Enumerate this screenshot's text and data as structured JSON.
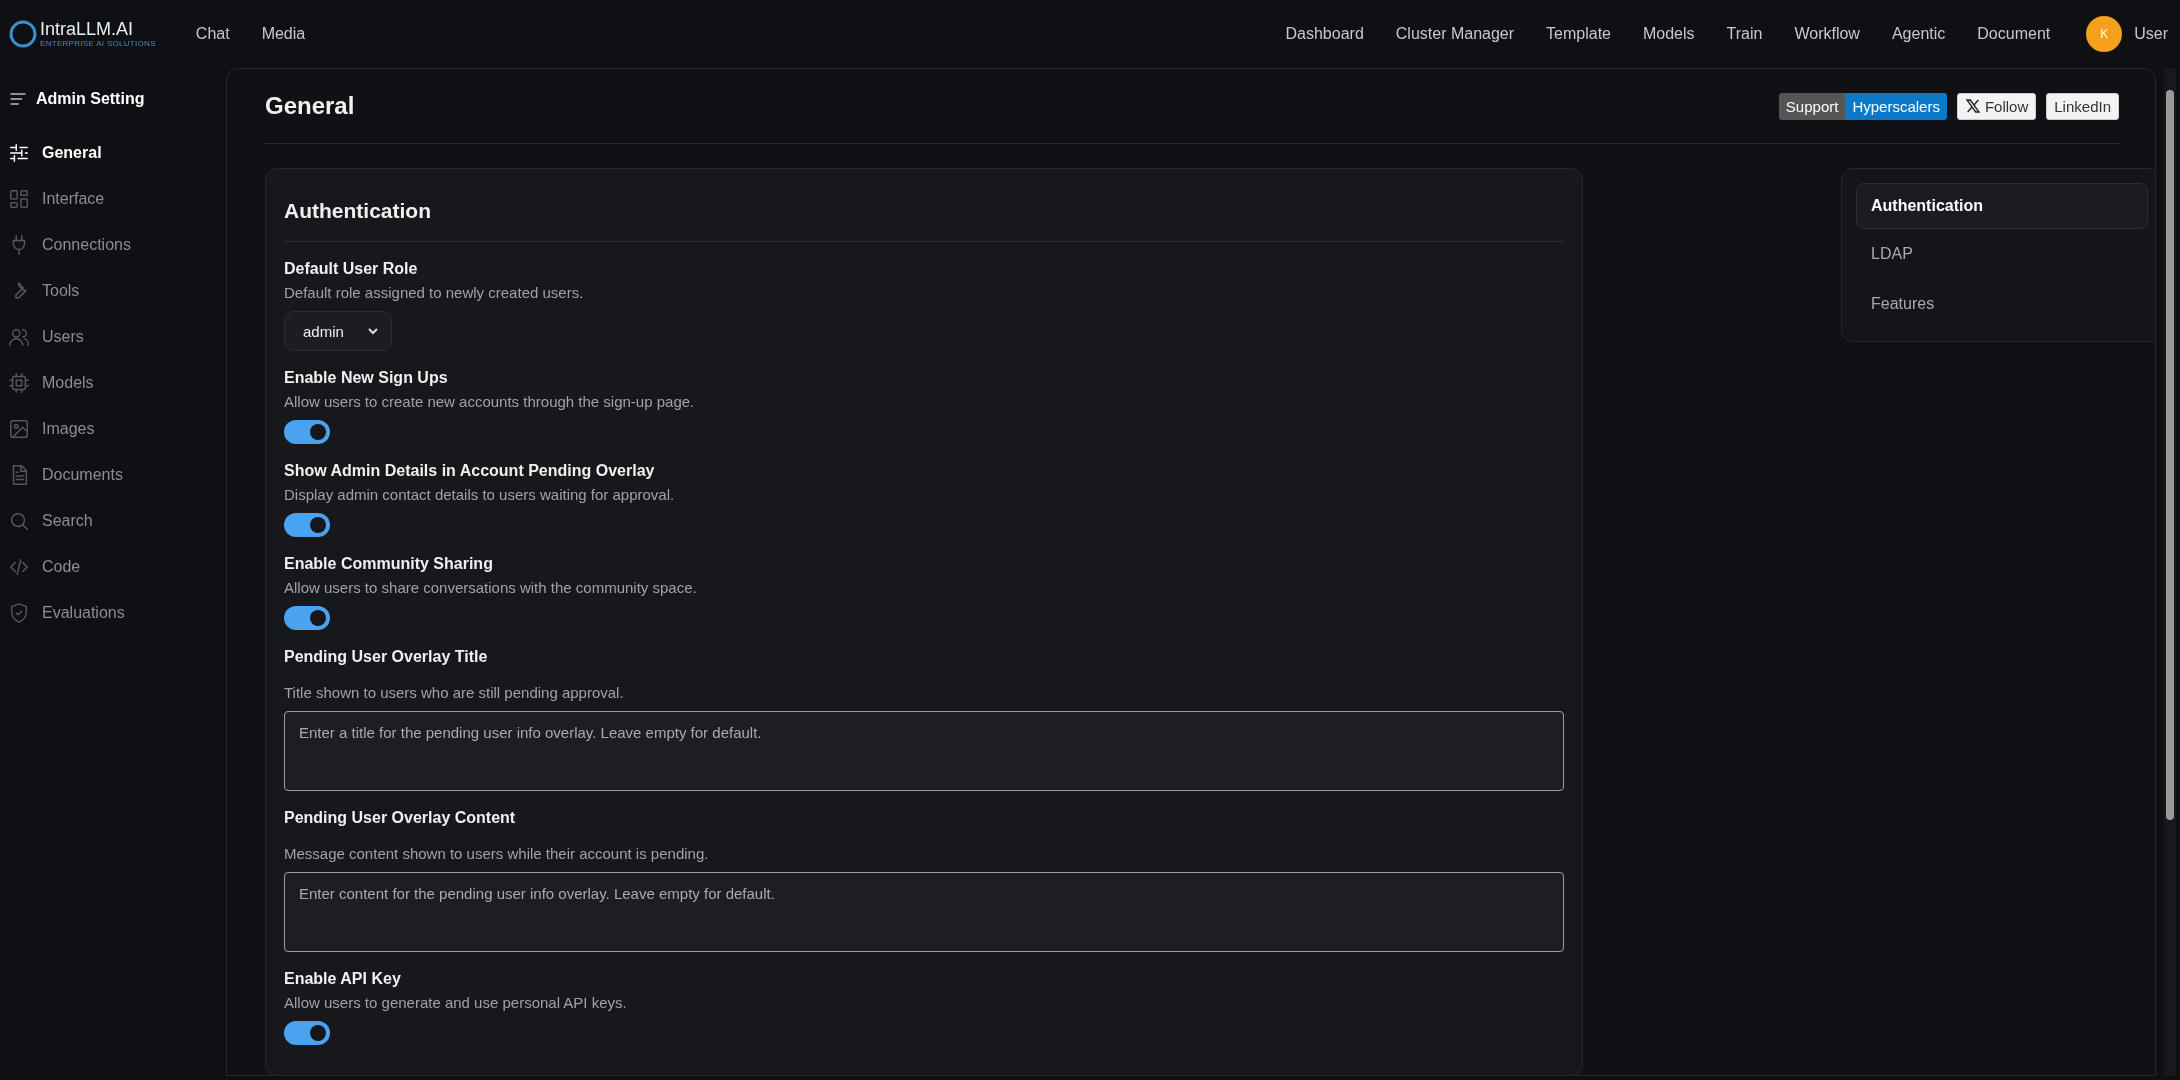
{
  "brand": {
    "name": "IntraLLM.AI",
    "tagline": "ENTERPRISE AI SOLUTIONS"
  },
  "nav_left": [
    "Chat",
    "Media"
  ],
  "nav_right": [
    "Dashboard",
    "Cluster Manager",
    "Template",
    "Models",
    "Train",
    "Workflow",
    "Agentic",
    "Document"
  ],
  "user": {
    "initial": "K",
    "name": "User"
  },
  "sidebar": {
    "title": "Admin Setting",
    "items": [
      {
        "label": "General",
        "selected": true
      },
      {
        "label": "Interface",
        "selected": false
      },
      {
        "label": "Connections",
        "selected": false
      },
      {
        "label": "Tools",
        "selected": false
      },
      {
        "label": "Users",
        "selected": false
      },
      {
        "label": "Models",
        "selected": false
      },
      {
        "label": "Images",
        "selected": false
      },
      {
        "label": "Documents",
        "selected": false
      },
      {
        "label": "Search",
        "selected": false
      },
      {
        "label": "Code",
        "selected": false
      },
      {
        "label": "Evaluations",
        "selected": false
      }
    ]
  },
  "page_title": "General",
  "badges": {
    "support": {
      "left": "Support",
      "right": "Hyperscalers"
    },
    "follow": "Follow",
    "linkedin": "LinkedIn"
  },
  "section": {
    "title": "Authentication",
    "settings": [
      {
        "kind": "select",
        "label": "Default User Role",
        "description": "Default role assigned to newly created users.",
        "value": "admin"
      },
      {
        "kind": "toggle",
        "label": "Enable New Sign Ups",
        "description": "Allow users to create new accounts through the sign-up page.",
        "on": true
      },
      {
        "kind": "toggle",
        "label": "Show Admin Details in Account Pending Overlay",
        "description": "Display admin contact details to users waiting for approval.",
        "on": true
      },
      {
        "kind": "toggle",
        "label": "Enable Community Sharing",
        "description": "Allow users to share conversations with the community space.",
        "on": true
      },
      {
        "kind": "textarea",
        "label": "Pending User Overlay Title",
        "description": "Title shown to users who are still pending approval.",
        "placeholder": "Enter a title for the pending user info overlay. Leave empty for default."
      },
      {
        "kind": "textarea",
        "label": "Pending User Overlay Content",
        "description": "Message content shown to users while their account is pending.",
        "placeholder": "Enter content for the pending user info overlay. Leave empty for default."
      },
      {
        "kind": "toggle",
        "label": "Enable API Key",
        "description": "Allow users to generate and use personal API keys.",
        "on": true
      }
    ]
  },
  "toc": [
    {
      "label": "Authentication",
      "selected": true
    },
    {
      "label": "LDAP",
      "selected": false
    },
    {
      "label": "Features",
      "selected": false
    }
  ]
}
